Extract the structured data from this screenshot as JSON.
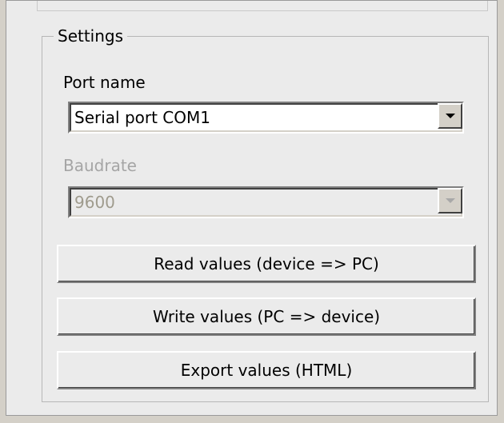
{
  "settings": {
    "legend": "Settings",
    "port_name": {
      "label": "Port name",
      "selected": "Serial port COM1",
      "enabled": true
    },
    "baudrate": {
      "label": "Baudrate",
      "selected": "9600",
      "enabled": false
    },
    "buttons": {
      "read": "Read values (device => PC)",
      "write": "Write values (PC => device)",
      "export": "Export values (HTML)"
    }
  },
  "icons": {
    "dropdown": "chevron-down-icon"
  },
  "colors": {
    "panel_background": "#ebebeb",
    "disabled_text": "#a5a5a5",
    "disabled_combo_text": "#9f9b8d"
  }
}
